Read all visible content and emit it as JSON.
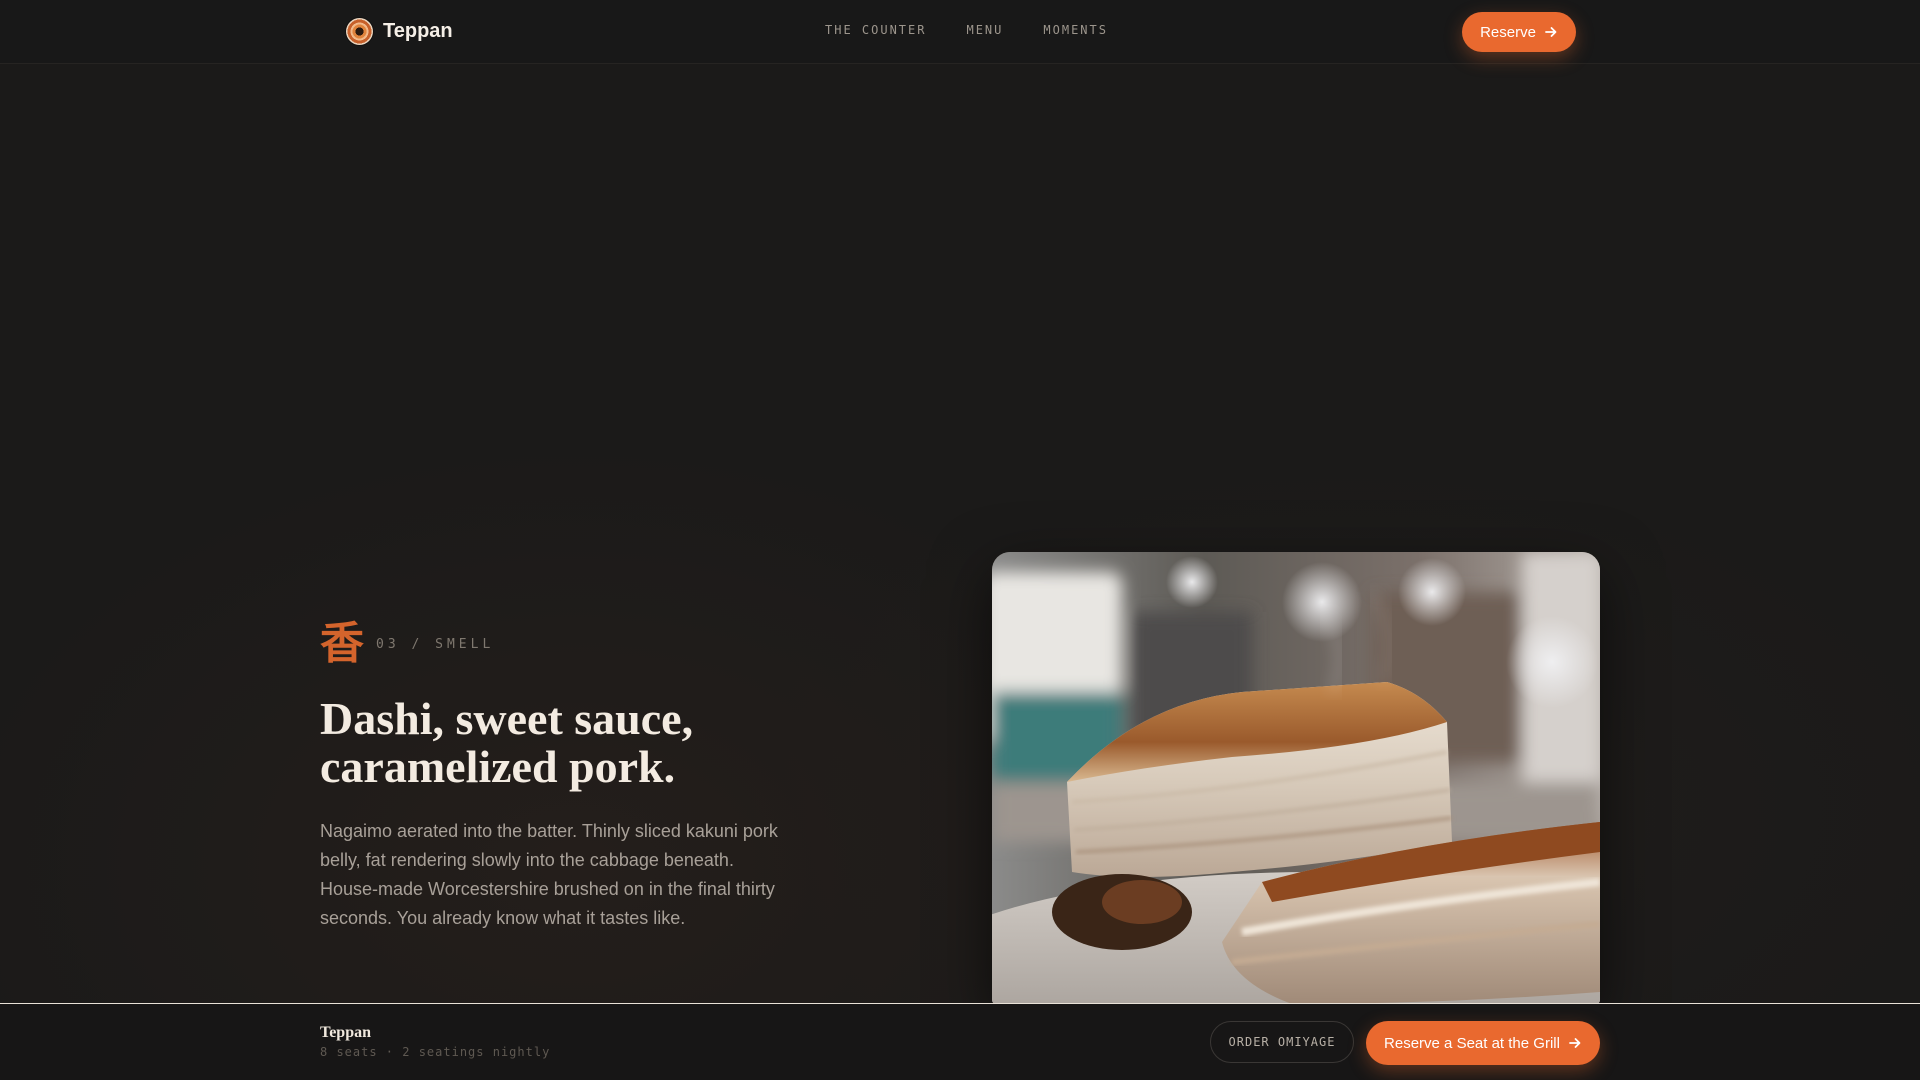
{
  "header": {
    "brand_name": "Teppan",
    "nav": [
      {
        "label": "THE COUNTER"
      },
      {
        "label": "MENU"
      },
      {
        "label": "MOMENTS"
      }
    ],
    "reserve_label": "Reserve"
  },
  "hero": {
    "kanji": "香",
    "section_tag": "03 / SMELL",
    "headline_line1": "Dashi, sweet sauce,",
    "headline_line2": "caramelized pork.",
    "body": "Nagaimo aerated into the batter. Thinly sliced kakuni pork belly, fat rendering slowly into the cabbage beneath. House-made Worcestershire brushed on in the final thirty seconds. You already know what it tastes like."
  },
  "footer": {
    "brand": "Teppan",
    "subtitle": "8 seats · 2 seatings nightly",
    "omiyage_label": "ORDER OMIYAGE",
    "grill_label": "Reserve a Seat at the Grill"
  },
  "colors": {
    "accent": "#e9692f",
    "background": "#1b1a19",
    "kanji": "#d4642c"
  },
  "icons": {
    "logo": "sun-logo-icon",
    "arrow": "arrow-right-icon"
  }
}
